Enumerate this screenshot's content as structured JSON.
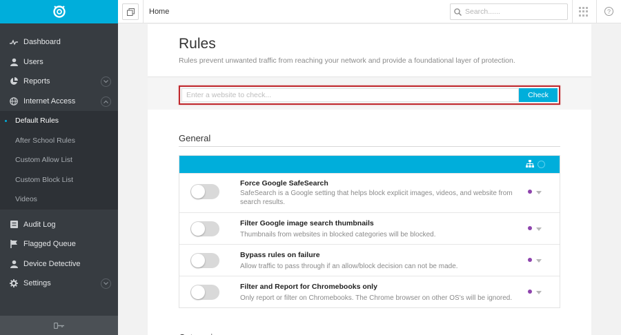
{
  "sidebar": {
    "items": [
      {
        "label": "Dashboard",
        "icon": "pulse-icon"
      },
      {
        "label": "Users",
        "icon": "user-icon"
      },
      {
        "label": "Reports",
        "icon": "pie-chart-icon"
      },
      {
        "label": "Internet Access",
        "icon": "globe-icon"
      }
    ],
    "subitems": [
      {
        "label": "Default Rules",
        "active": true
      },
      {
        "label": "After School Rules"
      },
      {
        "label": "Custom Allow List"
      },
      {
        "label": "Custom Block List"
      },
      {
        "label": "Videos"
      }
    ],
    "items2": [
      {
        "label": "Audit Log",
        "icon": "log-icon"
      },
      {
        "label": "Flagged Queue",
        "icon": "flag-icon"
      },
      {
        "label": "Device Detective",
        "icon": "user-icon"
      },
      {
        "label": "Settings",
        "icon": "gear-icon"
      }
    ]
  },
  "topbar": {
    "breadcrumb": "Home",
    "search_placeholder": "Search......"
  },
  "page": {
    "title": "Rules",
    "description": "Rules prevent unwanted traffic from reaching your network and provide a foundational layer of protection.",
    "check_placeholder": "Enter a website to check...",
    "check_button": "Check",
    "section_general": "General",
    "section_categories": "Categories"
  },
  "rules": [
    {
      "title": "Force Google SafeSearch",
      "desc": "SafeSearch is a Google setting that helps block explicit images, videos, and website from search results."
    },
    {
      "title": "Filter Google image search thumbnails",
      "desc": "Thumbnails from websites in blocked categories will be blocked."
    },
    {
      "title": "Bypass rules on failure",
      "desc": "Allow traffic to pass through if an allow/block decision can not be made."
    },
    {
      "title": "Filter and Report for Chromebooks only",
      "desc": "Only report or filter on Chromebooks. The Chrome browser on other OS's will be ignored."
    }
  ],
  "colors": {
    "accent": "#00aedb",
    "sidebar": "#373c41",
    "highlight": "#c0282d",
    "dot": "#8e44ad"
  }
}
